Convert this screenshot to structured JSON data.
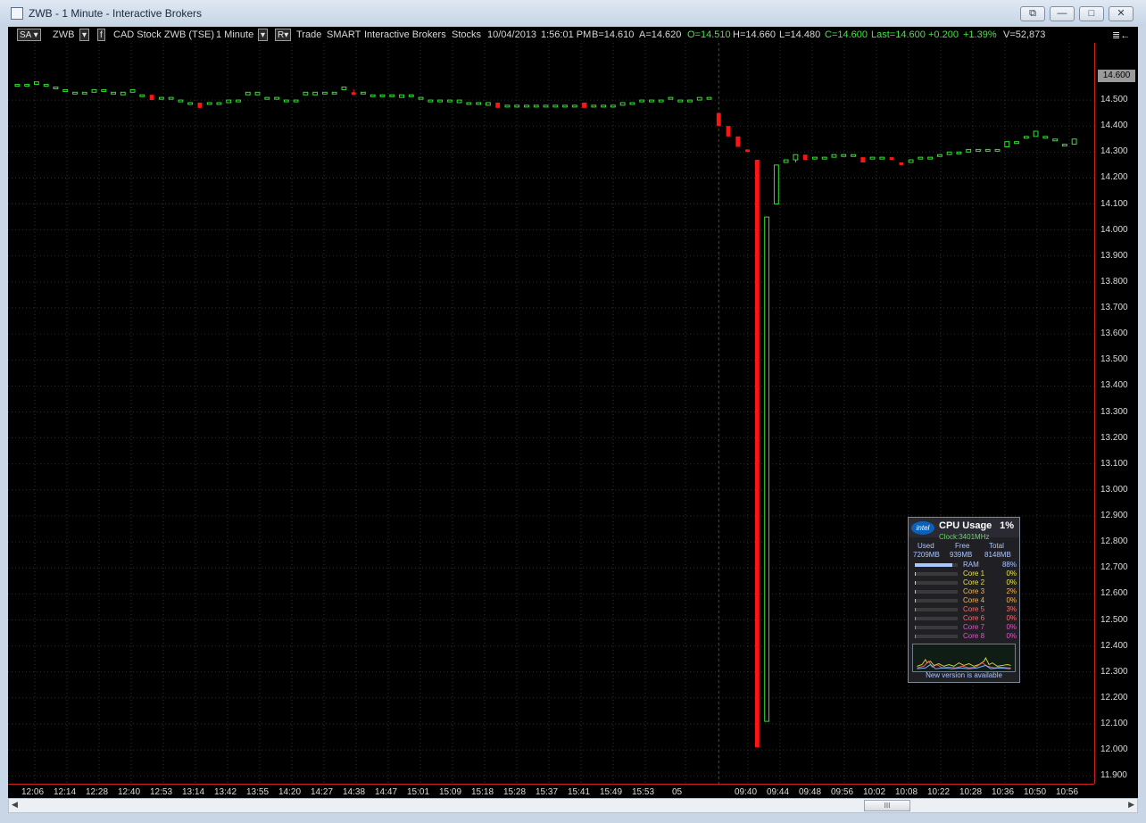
{
  "window": {
    "title": "ZWB - 1 Minute - Interactive Brokers",
    "controls": [
      "⧉",
      "—",
      "□",
      "✕"
    ]
  },
  "toolbar": {
    "sa_label": "SA",
    "symbol": "ZWB",
    "f_label": "f",
    "description": "CAD Stock ZWB (TSE)",
    "interval": "1 Minute",
    "r_label": "R",
    "trade": "Trade",
    "exchange": "SMART",
    "broker": "Interactive Brokers",
    "asset": "Stocks",
    "date": "10/04/2013",
    "time": "1:56:01 PM",
    "bid": "B=14.610",
    "ask": "A=14.620",
    "open": "O=14.510",
    "high": "H=14.660",
    "low": "L=14.480",
    "close": "C=14.600",
    "last": "Last=14.600",
    "change": "+0.200",
    "change_pct": "+1.39%",
    "volume": "V=52,873",
    "menu_icon": "≣←"
  },
  "chart_data": {
    "type": "candlestick",
    "price_tag": "14.600",
    "y_ticks": [
      "14.500",
      "14.400",
      "14.300",
      "14.200",
      "14.100",
      "14.000",
      "13.900",
      "13.800",
      "13.700",
      "13.600",
      "13.500",
      "13.400",
      "13.300",
      "13.200",
      "13.100",
      "13.000",
      "12.900",
      "12.800",
      "12.700",
      "12.600",
      "12.500",
      "12.400",
      "12.300",
      "12.200",
      "12.100",
      "12.000",
      "11.900"
    ],
    "ylim": [
      11.87,
      14.72
    ],
    "x_ticks": [
      "12:06",
      "12:14",
      "12:28",
      "12:40",
      "12:53",
      "13:14",
      "13:42",
      "13:55",
      "14:20",
      "14:27",
      "14:38",
      "14:47",
      "15:01",
      "15:09",
      "15:18",
      "15:28",
      "15:37",
      "15:41",
      "15:49",
      "15:53",
      "05",
      "09:40",
      "09:44",
      "09:48",
      "09:56",
      "10:02",
      "10:08",
      "10:22",
      "10:28",
      "10:36",
      "10:50",
      "10:56"
    ],
    "colors": {
      "up": "#33e033",
      "down": "#ff1414",
      "flat": "#8a8a8a",
      "axis": "#d02020",
      "grid": "#303030"
    },
    "candles": [
      [
        14.56,
        14.56,
        14.56,
        14.56
      ],
      [
        14.56,
        14.56,
        14.56,
        14.56
      ],
      [
        14.56,
        14.57,
        14.56,
        14.57
      ],
      [
        14.56,
        14.56,
        14.56,
        14.56
      ],
      [
        14.55,
        14.55,
        14.55,
        14.55
      ],
      [
        14.54,
        14.54,
        14.54,
        14.54
      ],
      [
        14.53,
        14.53,
        14.53,
        14.53
      ],
      [
        14.53,
        14.53,
        14.53,
        14.53
      ],
      [
        14.53,
        14.54,
        14.53,
        14.54
      ],
      [
        14.54,
        14.54,
        14.54,
        14.54
      ],
      [
        14.53,
        14.53,
        14.53,
        14.53
      ],
      [
        14.52,
        14.53,
        14.52,
        14.53
      ],
      [
        14.53,
        14.54,
        14.53,
        14.54
      ],
      [
        14.52,
        14.52,
        14.52,
        14.52
      ],
      [
        14.52,
        14.52,
        14.5,
        14.5
      ],
      [
        14.51,
        14.51,
        14.51,
        14.51
      ],
      [
        14.51,
        14.51,
        14.51,
        14.51
      ],
      [
        14.5,
        14.5,
        14.5,
        14.5
      ],
      [
        14.49,
        14.49,
        14.49,
        14.49
      ],
      [
        14.49,
        14.49,
        14.47,
        14.47
      ],
      [
        14.49,
        14.49,
        14.49,
        14.49
      ],
      [
        14.49,
        14.49,
        14.49,
        14.49
      ],
      [
        14.49,
        14.5,
        14.49,
        14.5
      ],
      [
        14.5,
        14.5,
        14.5,
        14.5
      ],
      [
        14.52,
        14.53,
        14.52,
        14.53
      ],
      [
        14.52,
        14.53,
        14.52,
        14.53
      ],
      [
        14.51,
        14.51,
        14.51,
        14.51
      ],
      [
        14.51,
        14.51,
        14.51,
        14.51
      ],
      [
        14.5,
        14.5,
        14.5,
        14.5
      ],
      [
        14.5,
        14.5,
        14.5,
        14.5
      ],
      [
        14.52,
        14.53,
        14.52,
        14.53
      ],
      [
        14.52,
        14.53,
        14.52,
        14.53
      ],
      [
        14.53,
        14.53,
        14.53,
        14.53
      ],
      [
        14.53,
        14.53,
        14.53,
        14.53
      ],
      [
        14.54,
        14.55,
        14.54,
        14.55
      ],
      [
        14.53,
        14.54,
        14.52,
        14.52
      ],
      [
        14.53,
        14.53,
        14.53,
        14.53
      ],
      [
        14.52,
        14.52,
        14.52,
        14.52
      ],
      [
        14.52,
        14.52,
        14.52,
        14.52
      ],
      [
        14.52,
        14.52,
        14.52,
        14.52
      ],
      [
        14.51,
        14.52,
        14.51,
        14.52
      ],
      [
        14.52,
        14.52,
        14.52,
        14.52
      ],
      [
        14.51,
        14.51,
        14.51,
        14.51
      ],
      [
        14.5,
        14.5,
        14.5,
        14.5
      ],
      [
        14.5,
        14.5,
        14.5,
        14.5
      ],
      [
        14.5,
        14.5,
        14.5,
        14.5
      ],
      [
        14.49,
        14.5,
        14.49,
        14.5
      ],
      [
        14.49,
        14.49,
        14.49,
        14.49
      ],
      [
        14.49,
        14.49,
        14.49,
        14.49
      ],
      [
        14.48,
        14.49,
        14.48,
        14.49
      ],
      [
        14.49,
        14.49,
        14.47,
        14.47
      ],
      [
        14.48,
        14.48,
        14.48,
        14.48
      ],
      [
        14.48,
        14.48,
        14.48,
        14.48
      ],
      [
        14.48,
        14.48,
        14.48,
        14.48
      ],
      [
        14.48,
        14.48,
        14.48,
        14.48
      ],
      [
        14.48,
        14.48,
        14.48,
        14.48
      ],
      [
        14.48,
        14.48,
        14.48,
        14.48
      ],
      [
        14.48,
        14.48,
        14.48,
        14.48
      ],
      [
        14.48,
        14.48,
        14.48,
        14.48
      ],
      [
        14.49,
        14.49,
        14.47,
        14.47
      ],
      [
        14.48,
        14.48,
        14.48,
        14.48
      ],
      [
        14.48,
        14.48,
        14.48,
        14.48
      ],
      [
        14.48,
        14.48,
        14.48,
        14.48
      ],
      [
        14.48,
        14.49,
        14.48,
        14.49
      ],
      [
        14.49,
        14.49,
        14.49,
        14.49
      ],
      [
        14.5,
        14.5,
        14.5,
        14.5
      ],
      [
        14.5,
        14.5,
        14.5,
        14.5
      ],
      [
        14.5,
        14.5,
        14.5,
        14.5
      ],
      [
        14.51,
        14.51,
        14.51,
        14.51
      ],
      [
        14.5,
        14.5,
        14.5,
        14.5
      ],
      [
        14.5,
        14.5,
        14.5,
        14.5
      ],
      [
        14.5,
        14.51,
        14.5,
        14.51
      ],
      [
        14.51,
        14.51,
        14.51,
        14.51
      ],
      [
        14.45,
        14.45,
        14.4,
        14.4
      ],
      [
        14.4,
        14.4,
        14.36,
        14.36
      ],
      [
        14.36,
        14.36,
        14.32,
        14.32
      ],
      [
        14.31,
        14.31,
        14.3,
        14.3
      ],
      [
        14.27,
        14.27,
        12.01,
        12.01
      ],
      [
        12.11,
        14.05,
        12.11,
        14.05
      ],
      [
        14.1,
        14.25,
        14.1,
        14.25
      ],
      [
        14.26,
        14.27,
        14.26,
        14.27
      ],
      [
        14.27,
        14.29,
        14.26,
        14.29
      ],
      [
        14.29,
        14.29,
        14.27,
        14.27
      ],
      [
        14.28,
        14.28,
        14.28,
        14.28
      ],
      [
        14.28,
        14.28,
        14.28,
        14.28
      ],
      [
        14.28,
        14.29,
        14.28,
        14.29
      ],
      [
        14.29,
        14.29,
        14.29,
        14.29
      ],
      [
        14.29,
        14.29,
        14.29,
        14.29
      ],
      [
        14.28,
        14.28,
        14.26,
        14.26
      ],
      [
        14.28,
        14.28,
        14.28,
        14.28
      ],
      [
        14.28,
        14.28,
        14.28,
        14.28
      ],
      [
        14.28,
        14.28,
        14.27,
        14.27
      ],
      [
        14.26,
        14.26,
        14.25,
        14.25
      ],
      [
        14.26,
        14.27,
        14.26,
        14.27
      ],
      [
        14.28,
        14.28,
        14.28,
        14.28
      ],
      [
        14.28,
        14.28,
        14.28,
        14.28
      ],
      [
        14.29,
        14.29,
        14.29,
        14.29
      ],
      [
        14.29,
        14.3,
        14.29,
        14.3
      ],
      [
        14.3,
        14.3,
        14.3,
        14.3
      ],
      [
        14.3,
        14.31,
        14.3,
        14.31
      ],
      [
        14.31,
        14.31,
        14.31,
        14.31
      ],
      [
        14.31,
        14.31,
        14.31,
        14.31
      ],
      [
        14.31,
        14.31,
        14.31,
        14.31
      ],
      [
        14.32,
        14.34,
        14.32,
        14.34
      ],
      [
        14.34,
        14.34,
        14.34,
        14.34
      ],
      [
        14.36,
        14.36,
        14.36,
        14.36
      ],
      [
        14.36,
        14.38,
        14.36,
        14.38
      ],
      [
        14.36,
        14.36,
        14.36,
        14.36
      ],
      [
        14.35,
        14.35,
        14.35,
        14.35
      ],
      [
        14.33,
        14.33,
        14.33,
        14.33
      ],
      [
        14.33,
        14.35,
        14.33,
        14.35
      ]
    ],
    "session_break_index": 73
  },
  "cpu_widget": {
    "brand": "intel",
    "title": "CPU Usage",
    "percent": "1%",
    "clock": "Clock:3401MHz",
    "col_used": "Used",
    "col_free": "Free",
    "col_total": "Total",
    "used": "7209MB",
    "free": "939MB",
    "total": "8148MB",
    "rows": [
      {
        "label": "RAM",
        "pct": "88%",
        "level": 0.88,
        "color": "#a9c7ff"
      },
      {
        "label": "Core 1",
        "pct": "0%",
        "level": 0.0,
        "color": "#e7e34a"
      },
      {
        "label": "Core 2",
        "pct": "0%",
        "level": 0.0,
        "color": "#e7e34a"
      },
      {
        "label": "Core 3",
        "pct": "2%",
        "level": 0.02,
        "color": "#f2b84a"
      },
      {
        "label": "Core 4",
        "pct": "0%",
        "level": 0.0,
        "color": "#f2b84a"
      },
      {
        "label": "Core 5",
        "pct": "3%",
        "level": 0.03,
        "color": "#ff6a6a"
      },
      {
        "label": "Core 6",
        "pct": "0%",
        "level": 0.0,
        "color": "#ff6a6a"
      },
      {
        "label": "Core 7",
        "pct": "0%",
        "level": 0.0,
        "color": "#e058c8"
      },
      {
        "label": "Core 8",
        "pct": "0%",
        "level": 0.0,
        "color": "#e058c8"
      }
    ],
    "new_version": "New version is available"
  },
  "hscroll": {
    "left_arrow": "◀",
    "right_arrow": "▶",
    "thumb_grip": "III"
  }
}
